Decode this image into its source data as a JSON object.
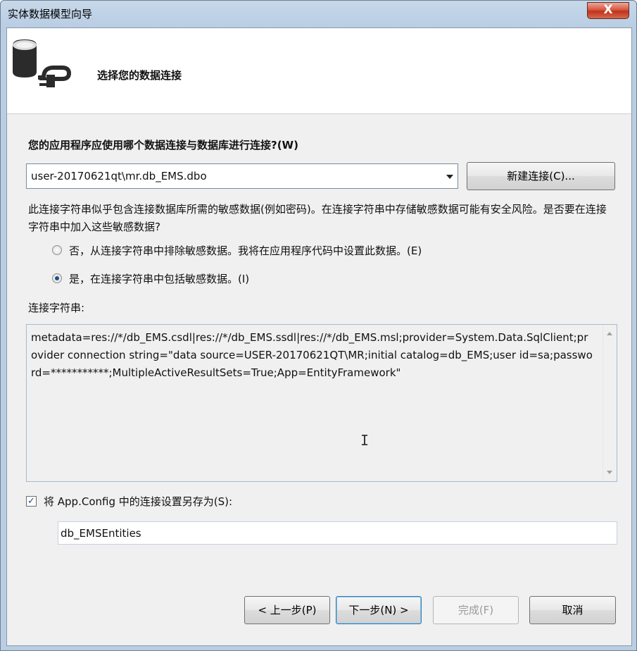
{
  "window": {
    "title": "实体数据模型向导",
    "close_glyph": "X"
  },
  "banner": {
    "title": "选择您的数据连接",
    "icon": "database-plug-icon"
  },
  "connection": {
    "prompt": "您的应用程序应使用哪个数据连接与数据库进行连接?(W)",
    "selected": "user-20170621qt\\mr.db_EMS.dbo",
    "new_connection_label": "新建连接(C)..."
  },
  "sensitive": {
    "warning": "此连接字符串似乎包含连接数据库所需的敏感数据(例如密码)。在连接字符串中存储敏感数据可能有安全风险。是否要在连接字符串中加入这些敏感数据?",
    "option_no": "否，从连接字符串中排除敏感数据。我将在应用程序代码中设置此数据。(E)",
    "option_yes": "是，在连接字符串中包括敏感数据。(I)",
    "selected_option": "yes"
  },
  "connection_string": {
    "label": "连接字符串:",
    "value": "metadata=res://*/db_EMS.csdl|res://*/db_EMS.ssdl|res://*/db_EMS.msl;provider=System.Data.SqlClient;provider connection string=\"data source=USER-20170621QT\\MR;initial catalog=db_EMS;user id=sa;password=***********;MultipleActiveResultSets=True;App=EntityFramework\""
  },
  "save_settings": {
    "checked": true,
    "label": "将 App.Config 中的连接设置另存为(S):",
    "value": "db_EMSEntities"
  },
  "buttons": {
    "back": "< 上一步(P)",
    "next": "下一步(N) >",
    "finish": "完成(F)",
    "cancel": "取消"
  }
}
